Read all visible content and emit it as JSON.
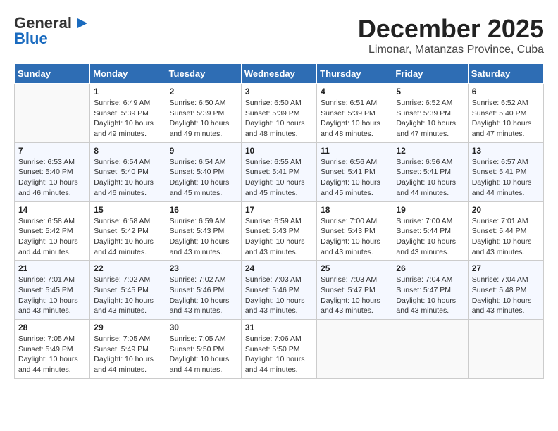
{
  "header": {
    "logo_general": "General",
    "logo_blue": "Blue",
    "month_title": "December 2025",
    "location": "Limonar, Matanzas Province, Cuba"
  },
  "weekdays": [
    "Sunday",
    "Monday",
    "Tuesday",
    "Wednesday",
    "Thursday",
    "Friday",
    "Saturday"
  ],
  "weeks": [
    [
      {
        "day": "",
        "info": ""
      },
      {
        "day": "1",
        "info": "Sunrise: 6:49 AM\nSunset: 5:39 PM\nDaylight: 10 hours\nand 49 minutes."
      },
      {
        "day": "2",
        "info": "Sunrise: 6:50 AM\nSunset: 5:39 PM\nDaylight: 10 hours\nand 49 minutes."
      },
      {
        "day": "3",
        "info": "Sunrise: 6:50 AM\nSunset: 5:39 PM\nDaylight: 10 hours\nand 48 minutes."
      },
      {
        "day": "4",
        "info": "Sunrise: 6:51 AM\nSunset: 5:39 PM\nDaylight: 10 hours\nand 48 minutes."
      },
      {
        "day": "5",
        "info": "Sunrise: 6:52 AM\nSunset: 5:39 PM\nDaylight: 10 hours\nand 47 minutes."
      },
      {
        "day": "6",
        "info": "Sunrise: 6:52 AM\nSunset: 5:40 PM\nDaylight: 10 hours\nand 47 minutes."
      }
    ],
    [
      {
        "day": "7",
        "info": "Sunrise: 6:53 AM\nSunset: 5:40 PM\nDaylight: 10 hours\nand 46 minutes."
      },
      {
        "day": "8",
        "info": "Sunrise: 6:54 AM\nSunset: 5:40 PM\nDaylight: 10 hours\nand 46 minutes."
      },
      {
        "day": "9",
        "info": "Sunrise: 6:54 AM\nSunset: 5:40 PM\nDaylight: 10 hours\nand 45 minutes."
      },
      {
        "day": "10",
        "info": "Sunrise: 6:55 AM\nSunset: 5:41 PM\nDaylight: 10 hours\nand 45 minutes."
      },
      {
        "day": "11",
        "info": "Sunrise: 6:56 AM\nSunset: 5:41 PM\nDaylight: 10 hours\nand 45 minutes."
      },
      {
        "day": "12",
        "info": "Sunrise: 6:56 AM\nSunset: 5:41 PM\nDaylight: 10 hours\nand 44 minutes."
      },
      {
        "day": "13",
        "info": "Sunrise: 6:57 AM\nSunset: 5:41 PM\nDaylight: 10 hours\nand 44 minutes."
      }
    ],
    [
      {
        "day": "14",
        "info": "Sunrise: 6:58 AM\nSunset: 5:42 PM\nDaylight: 10 hours\nand 44 minutes."
      },
      {
        "day": "15",
        "info": "Sunrise: 6:58 AM\nSunset: 5:42 PM\nDaylight: 10 hours\nand 44 minutes."
      },
      {
        "day": "16",
        "info": "Sunrise: 6:59 AM\nSunset: 5:43 PM\nDaylight: 10 hours\nand 43 minutes."
      },
      {
        "day": "17",
        "info": "Sunrise: 6:59 AM\nSunset: 5:43 PM\nDaylight: 10 hours\nand 43 minutes."
      },
      {
        "day": "18",
        "info": "Sunrise: 7:00 AM\nSunset: 5:43 PM\nDaylight: 10 hours\nand 43 minutes."
      },
      {
        "day": "19",
        "info": "Sunrise: 7:00 AM\nSunset: 5:44 PM\nDaylight: 10 hours\nand 43 minutes."
      },
      {
        "day": "20",
        "info": "Sunrise: 7:01 AM\nSunset: 5:44 PM\nDaylight: 10 hours\nand 43 minutes."
      }
    ],
    [
      {
        "day": "21",
        "info": "Sunrise: 7:01 AM\nSunset: 5:45 PM\nDaylight: 10 hours\nand 43 minutes."
      },
      {
        "day": "22",
        "info": "Sunrise: 7:02 AM\nSunset: 5:45 PM\nDaylight: 10 hours\nand 43 minutes."
      },
      {
        "day": "23",
        "info": "Sunrise: 7:02 AM\nSunset: 5:46 PM\nDaylight: 10 hours\nand 43 minutes."
      },
      {
        "day": "24",
        "info": "Sunrise: 7:03 AM\nSunset: 5:46 PM\nDaylight: 10 hours\nand 43 minutes."
      },
      {
        "day": "25",
        "info": "Sunrise: 7:03 AM\nSunset: 5:47 PM\nDaylight: 10 hours\nand 43 minutes."
      },
      {
        "day": "26",
        "info": "Sunrise: 7:04 AM\nSunset: 5:47 PM\nDaylight: 10 hours\nand 43 minutes."
      },
      {
        "day": "27",
        "info": "Sunrise: 7:04 AM\nSunset: 5:48 PM\nDaylight: 10 hours\nand 43 minutes."
      }
    ],
    [
      {
        "day": "28",
        "info": "Sunrise: 7:05 AM\nSunset: 5:49 PM\nDaylight: 10 hours\nand 44 minutes."
      },
      {
        "day": "29",
        "info": "Sunrise: 7:05 AM\nSunset: 5:49 PM\nDaylight: 10 hours\nand 44 minutes."
      },
      {
        "day": "30",
        "info": "Sunrise: 7:05 AM\nSunset: 5:50 PM\nDaylight: 10 hours\nand 44 minutes."
      },
      {
        "day": "31",
        "info": "Sunrise: 7:06 AM\nSunset: 5:50 PM\nDaylight: 10 hours\nand 44 minutes."
      },
      {
        "day": "",
        "info": ""
      },
      {
        "day": "",
        "info": ""
      },
      {
        "day": "",
        "info": ""
      }
    ]
  ]
}
